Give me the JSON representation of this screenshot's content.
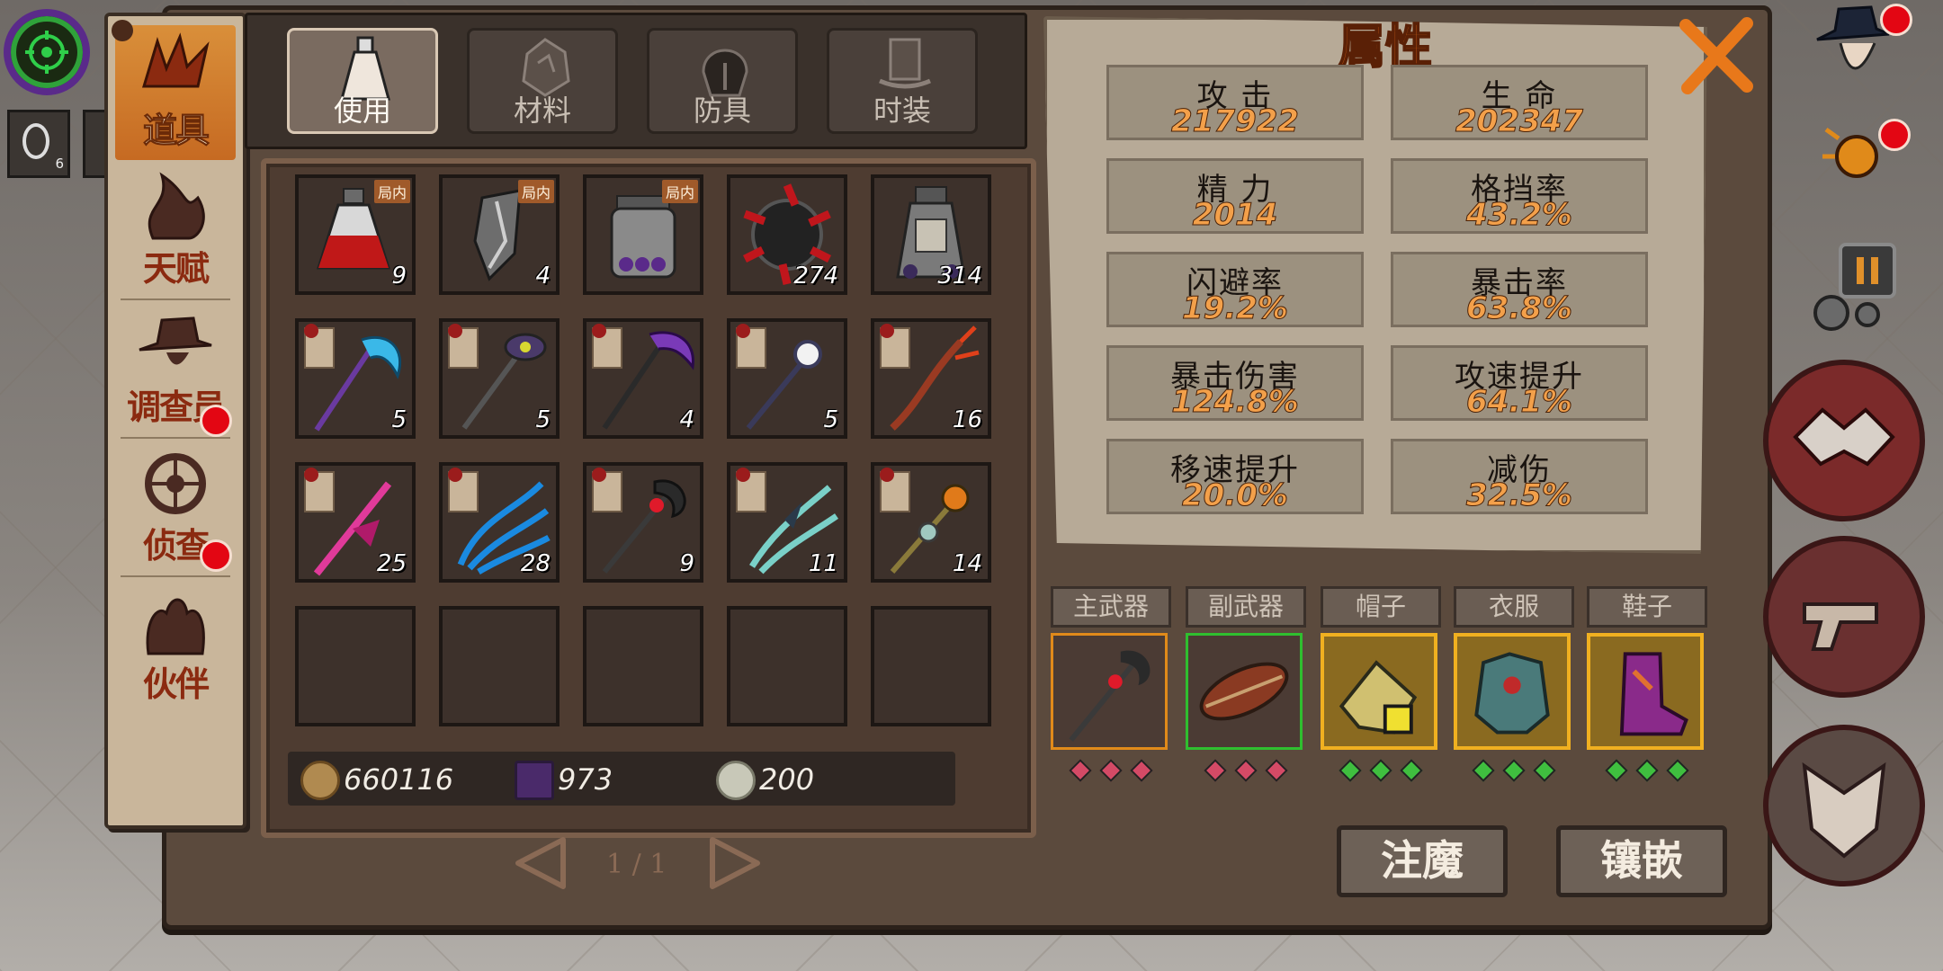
{
  "hud": {
    "chip_count": "6"
  },
  "sidebar": {
    "items": [
      {
        "label": "道具",
        "active": true
      },
      {
        "label": "天赋"
      },
      {
        "label": "调查员"
      },
      {
        "label": "侦查"
      },
      {
        "label": "伙伴"
      }
    ]
  },
  "tabs": [
    {
      "label": "使用",
      "icon": "potion-bottle-icon",
      "active": true
    },
    {
      "label": "材料",
      "icon": "ore-icon"
    },
    {
      "label": "防具",
      "icon": "helmet-icon"
    },
    {
      "label": "时装",
      "icon": "top-hat-icon"
    }
  ],
  "inventory": {
    "row1": [
      {
        "item": "red-potion",
        "count": "9",
        "tag": "局内"
      },
      {
        "item": "crystal-shard",
        "count": "4",
        "tag": "局内"
      },
      {
        "item": "purple-bead-jar",
        "count": "",
        "tag": "局内"
      },
      {
        "item": "dark-gem",
        "count": "274"
      },
      {
        "item": "rune-jar",
        "count": "314"
      }
    ],
    "row2": [
      {
        "item": "blue-scythe",
        "count": "5"
      },
      {
        "item": "eye-staff",
        "count": "5"
      },
      {
        "item": "purple-scythe",
        "count": "4"
      },
      {
        "item": "orb-staff",
        "count": "5"
      },
      {
        "item": "flame-staff",
        "count": "16"
      }
    ],
    "row3": [
      {
        "item": "pink-blade",
        "count": "25"
      },
      {
        "item": "blue-claw",
        "count": "28"
      },
      {
        "item": "blood-axe",
        "count": "9"
      },
      {
        "item": "frost-claw",
        "count": "11"
      },
      {
        "item": "lantern-staff",
        "count": "14"
      }
    ]
  },
  "currency": {
    "gold": "660116",
    "book": "973",
    "token": "200"
  },
  "pager": {
    "text": "1 / 1"
  },
  "attributes": {
    "title": "属性",
    "stats": [
      {
        "k": "攻  击",
        "v": "217922"
      },
      {
        "k": "生  命",
        "v": "202347"
      },
      {
        "k": "精  力",
        "v": "2014"
      },
      {
        "k": "格挡率",
        "v": "43.2%"
      },
      {
        "k": "闪避率",
        "v": "19.2%"
      },
      {
        "k": "暴击率",
        "v": "63.8%"
      },
      {
        "k": "暴击伤害",
        "v": "124.8%"
      },
      {
        "k": "攻速提升",
        "v": "64.1%"
      },
      {
        "k": "移速提升",
        "v": "20.0%"
      },
      {
        "k": "减伤",
        "v": "32.5%"
      }
    ]
  },
  "equipment": [
    {
      "slot": "主武器",
      "border": "#e08a1a",
      "gem": "#d44a66"
    },
    {
      "slot": "副武器",
      "border": "#2fbf2f",
      "gem": "#d44a66"
    },
    {
      "slot": "帽子",
      "border": "#f0b020",
      "gem": "#3fbf3f"
    },
    {
      "slot": "衣服",
      "border": "#f0b020",
      "gem": "#3fbf3f"
    },
    {
      "slot": "鞋子",
      "border": "#f0b020",
      "gem": "#3fbf3f"
    }
  ],
  "buttons": {
    "enchant": "注魔",
    "inlay": "镶嵌"
  }
}
